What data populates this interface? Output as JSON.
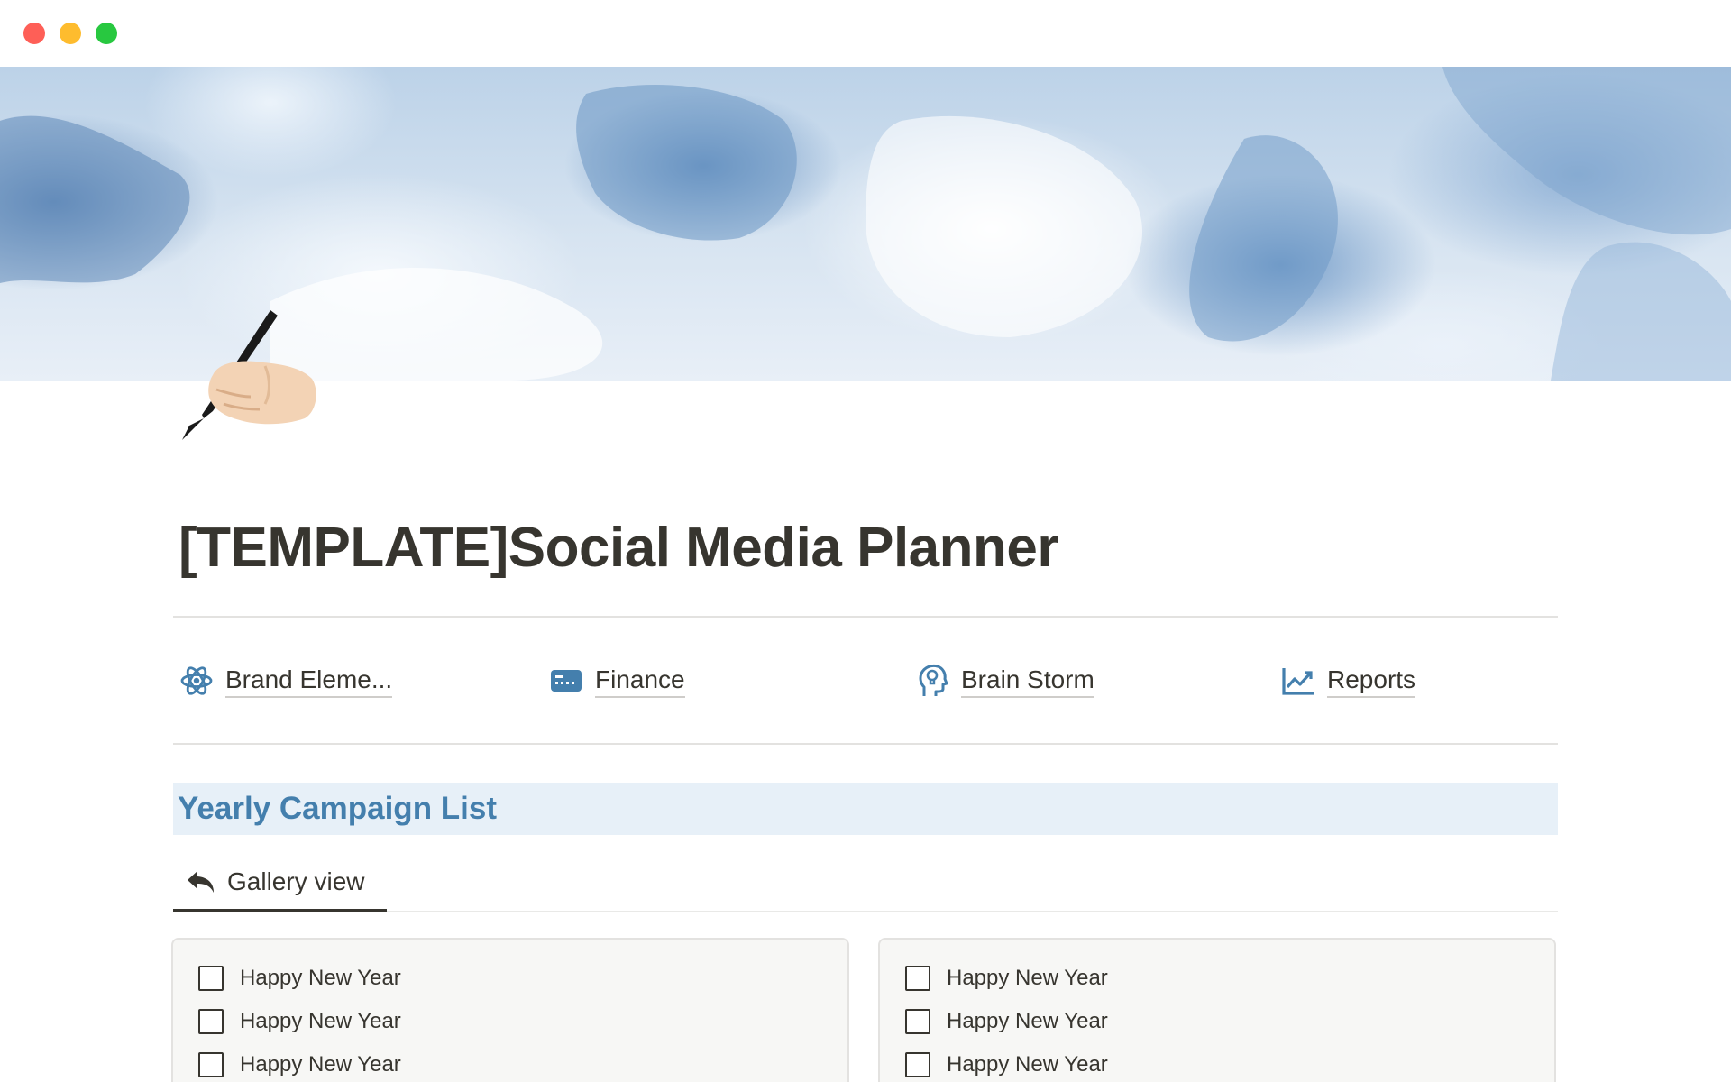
{
  "window": {
    "controls": [
      "close",
      "minimize",
      "maximize"
    ]
  },
  "page": {
    "icon": "writing-hand-icon",
    "title": "[TEMPLATE]Social Media Planner"
  },
  "links": [
    {
      "label": "Brand Eleme...",
      "icon": "atom-icon"
    },
    {
      "label": "Finance",
      "icon": "credit-card-icon"
    },
    {
      "label": "Brain Storm",
      "icon": "head-bulb-icon"
    },
    {
      "label": "Reports",
      "icon": "chart-line-icon"
    }
  ],
  "section": {
    "heading": "Yearly Campaign List"
  },
  "views": {
    "tabs": [
      {
        "label": "Gallery view",
        "icon": "reply-arrow-icon"
      }
    ]
  },
  "gallery": {
    "cards": [
      {
        "items": [
          {
            "label": "Happy New Year",
            "checked": false
          },
          {
            "label": "Happy New Year",
            "checked": false
          },
          {
            "label": "Happy New Year",
            "checked": false
          }
        ]
      },
      {
        "items": [
          {
            "label": "Happy New Year",
            "checked": false
          },
          {
            "label": "Happy New Year",
            "checked": false
          },
          {
            "label": "Happy New Year",
            "checked": false
          }
        ]
      }
    ]
  },
  "colors": {
    "accent_blue": "#447fad",
    "heading_bg": "#e7f0f8",
    "text": "#37352f",
    "close": "#fe5f57",
    "minimize": "#febc2e",
    "maximize": "#28c840"
  }
}
